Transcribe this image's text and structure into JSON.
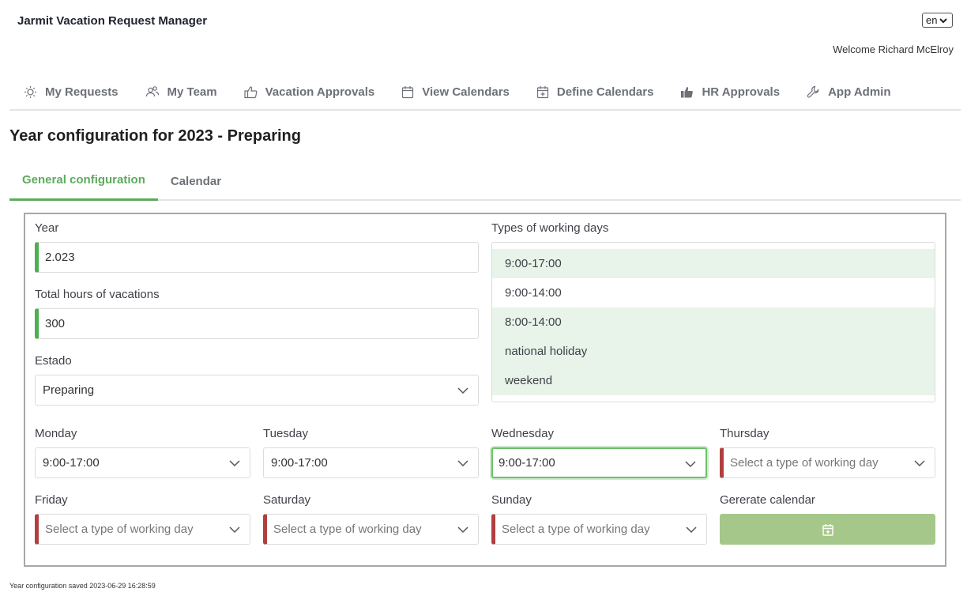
{
  "app": {
    "title": "Jarmit Vacation Request Manager",
    "language": "en",
    "welcome": "Welcome Richard McElroy"
  },
  "nav": {
    "items": [
      {
        "label": "My Requests",
        "icon": "sun-icon"
      },
      {
        "label": "My Team",
        "icon": "users-icon"
      },
      {
        "label": "Vacation Approvals",
        "icon": "thumbs-up-outline-icon"
      },
      {
        "label": "View Calendars",
        "icon": "calendar-icon"
      },
      {
        "label": "Define Calendars",
        "icon": "calendar-plus-icon"
      },
      {
        "label": "HR Approvals",
        "icon": "thumbs-up-filled-icon"
      },
      {
        "label": "App Admin",
        "icon": "wrench-icon"
      }
    ]
  },
  "page": {
    "title": "Year configuration for 2023 - Preparing"
  },
  "tabs": [
    {
      "label": "General configuration",
      "active": true
    },
    {
      "label": "Calendar",
      "active": false
    }
  ],
  "form": {
    "year": {
      "label": "Year",
      "value": "2.023"
    },
    "total_hours": {
      "label": "Total hours of vacations",
      "value": "300"
    },
    "estado": {
      "label": "Estado",
      "value": "Preparing"
    },
    "types_of_working_days": {
      "label": "Types of working days",
      "options": [
        {
          "label": "9:00-17:00",
          "selected": true
        },
        {
          "label": "9:00-14:00",
          "selected": false
        },
        {
          "label": "8:00-14:00",
          "selected": true
        },
        {
          "label": "national holiday",
          "selected": true
        },
        {
          "label": "weekend",
          "selected": true
        }
      ]
    },
    "days": {
      "monday": {
        "label": "Monday",
        "value": "9:00-17:00"
      },
      "tuesday": {
        "label": "Tuesday",
        "value": "9:00-17:00"
      },
      "wednesday": {
        "label": "Wednesday",
        "value": "9:00-17:00"
      },
      "thursday": {
        "label": "Thursday",
        "value": "",
        "placeholder": "Select a type of working day"
      },
      "friday": {
        "label": "Friday",
        "value": "",
        "placeholder": "Select a type of working day"
      },
      "saturday": {
        "label": "Saturday",
        "value": "",
        "placeholder": "Select a type of working day"
      },
      "sunday": {
        "label": "Sunday",
        "value": "",
        "placeholder": "Select a type of working day"
      }
    },
    "generate": {
      "label": "Gererate calendar",
      "icon": "calendar-plus-icon"
    }
  },
  "status": {
    "message": "Year configuration saved 2023-06-29 16:28:59"
  },
  "colors": {
    "accent": "#5cab5c",
    "valid": "#4caf50",
    "invalid": "#b0403f",
    "selected_row": "#e8f4ea",
    "button": "#a6c78a"
  }
}
